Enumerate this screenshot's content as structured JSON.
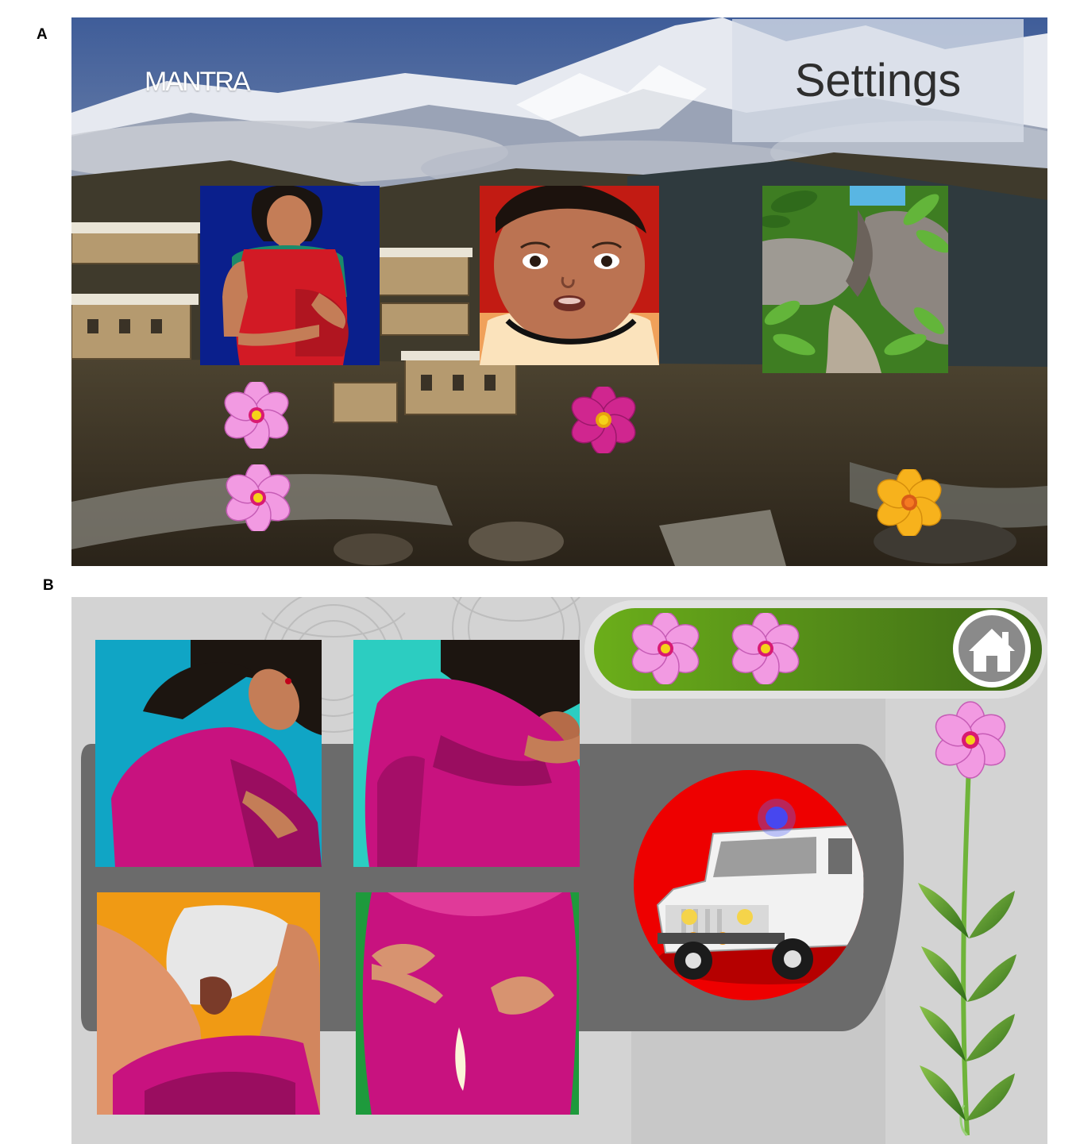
{
  "figure": {
    "panel_a_label": "A",
    "panel_b_label": "B"
  },
  "screen_a": {
    "logo_text": "MANTRA",
    "settings_label": "Settings",
    "tiles": [
      {
        "icon": "pregnant-woman"
      },
      {
        "icon": "baby-face"
      },
      {
        "icon": "forest-path"
      }
    ],
    "flowers": [
      "pink-flower",
      "pink-flower",
      "magenta-flower",
      "orange-flower"
    ]
  },
  "screen_b": {
    "header_flowers": [
      "pink-flower",
      "pink-flower"
    ],
    "home_icon": "home-icon",
    "danger_sign_tiles": [
      "woman-headache",
      "woman-vomiting",
      "childbirth",
      "fluid-leak"
    ],
    "emergency_icon": "ambulance-jeep",
    "progress_icon": "flower-stem",
    "colors": {
      "header_green": "#5e9a1a",
      "ambulance_red": "#ee0000",
      "track_gray": "#6b6b6b",
      "dress_magenta": "#c8127f"
    }
  }
}
